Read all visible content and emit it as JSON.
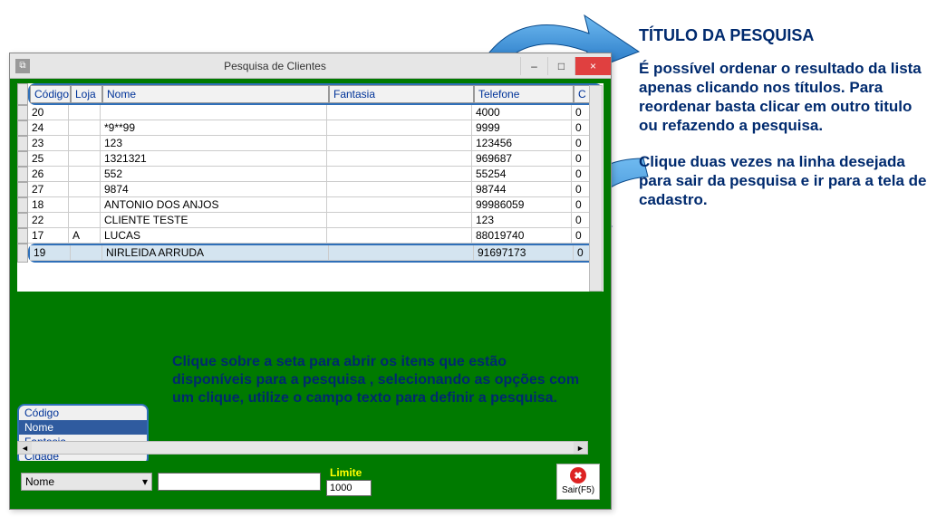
{
  "window": {
    "title": "Pesquisa de Clientes",
    "min": "–",
    "max": "□",
    "close": "×"
  },
  "grid": {
    "headers": {
      "codigo": "Código",
      "loja": "Loja",
      "nome": "Nome",
      "fantasia": "Fantasia",
      "telefone": "Telefone",
      "c": "C"
    },
    "rows": [
      {
        "codigo": "20",
        "loja": "",
        "nome": "",
        "fantasia": "",
        "telefone": "4000",
        "c": "0"
      },
      {
        "codigo": "24",
        "loja": "",
        "nome": "*9**99",
        "fantasia": "",
        "telefone": "9999",
        "c": "0"
      },
      {
        "codigo": "23",
        "loja": "",
        "nome": "123",
        "fantasia": "",
        "telefone": "123456",
        "c": "0"
      },
      {
        "codigo": "25",
        "loja": "",
        "nome": "1321321",
        "fantasia": "",
        "telefone": "969687",
        "c": "0"
      },
      {
        "codigo": "26",
        "loja": "",
        "nome": "552",
        "fantasia": "",
        "telefone": "55254",
        "c": "0"
      },
      {
        "codigo": "27",
        "loja": "",
        "nome": "9874",
        "fantasia": "",
        "telefone": "98744",
        "c": "0"
      },
      {
        "codigo": "18",
        "loja": "",
        "nome": "ANTONIO DOS ANJOS",
        "fantasia": "",
        "telefone": "99986059",
        "c": "0"
      },
      {
        "codigo": "22",
        "loja": "",
        "nome": "CLIENTE TESTE",
        "fantasia": "",
        "telefone": "123",
        "c": "0"
      },
      {
        "codigo": "17",
        "loja": "A",
        "nome": "LUCAS",
        "fantasia": "",
        "telefone": "88019740",
        "c": "0"
      },
      {
        "codigo": "19",
        "loja": "",
        "nome": "NIRLEIDA   ARRUDA",
        "fantasia": "",
        "telefone": "91697173",
        "c": "0",
        "highlight": true
      }
    ]
  },
  "options": {
    "items": [
      "Código",
      "Nome",
      "Fantasia",
      "Cidade"
    ],
    "selected": "Nome"
  },
  "bottom": {
    "dropdown_value": "Nome",
    "limite_label": "Limite",
    "limite_value": "1000",
    "exit_label": "Sair(F5)"
  },
  "annotations": {
    "title": "TÍTULO DA PESQUISA",
    "para1": "É possível ordenar o resultado da lista apenas clicando nos títulos. Para reordenar basta clicar em outro titulo ou refazendo a pesquisa.",
    "para2": "Clique duas vezes na linha desejada para sair da pesquisa e ir para a tela de cadastro.",
    "mid": "Clique sobre a seta para abrir os itens que estão disponíveis para a pesquisa , selecionando as opções com um clique, utilize o campo texto para  definir a pesquisa."
  }
}
